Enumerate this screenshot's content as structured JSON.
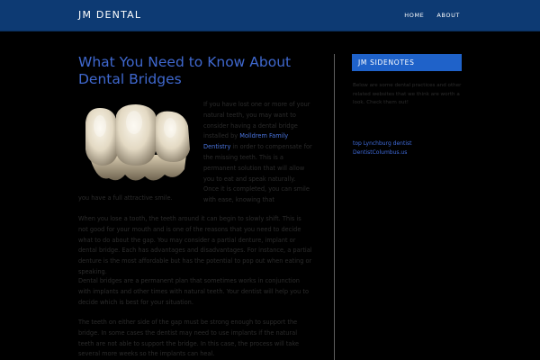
{
  "header": {
    "site_title": "JM DENTAL",
    "nav": [
      {
        "label": "HOME"
      },
      {
        "label": "ABOUT"
      }
    ]
  },
  "post": {
    "title": "What You Need to Know About Dental Bridges",
    "intro_before_link": "If you have lost one or more of your natural teeth, you may want to consider having a dental bridge installed by ",
    "intro_link": "Molldrem Family Dentistry",
    "intro_after_link": " in order to compensate for the missing teeth. This is a permanent solution that will allow you to eat and speak naturally. Once it is completed, you can smile with ease, knowing that",
    "intro_continuation": "you have a full attractive smile.",
    "paragraphs": [
      "When you lose a tooth, the teeth around it can begin to slowly shift. This is not good for your mouth and is one of the reasons that you need to decide what to do about the gap. You may consider a partial denture, implant or dental bridge. Each has advantages and disadvantages. For instance, a partial denture is the most affordable but has the potential to pop out when eating or speaking.",
      "Dental bridges are a permanent plan that sometimes works in conjunction with implants and other times with natural teeth. Your dentist will help you to decide which is best for your situation.",
      "The teeth on either side of the gap must be strong enough to support the bridge. In some cases the dentist may need to use implants if the natural teeth are not able to support the bridge. In this case, the process will take several more weeks so the implants can heal."
    ]
  },
  "sidebar": {
    "widget_title": "JM SIDENOTES",
    "description": "Below are some dental practices and other related websites that we think are worth a look. Check them out!",
    "links": [
      {
        "label": "top Lynchburg dentist"
      },
      {
        "label": "DentistColumbus.us"
      }
    ]
  },
  "colors": {
    "header_bg": "#0d3a73",
    "accent_blue": "#1f62c9",
    "title_blue": "#3f68cf",
    "link_blue": "#4a74dd",
    "page_bg": "#000000",
    "body_text": "#2b2b2b"
  }
}
